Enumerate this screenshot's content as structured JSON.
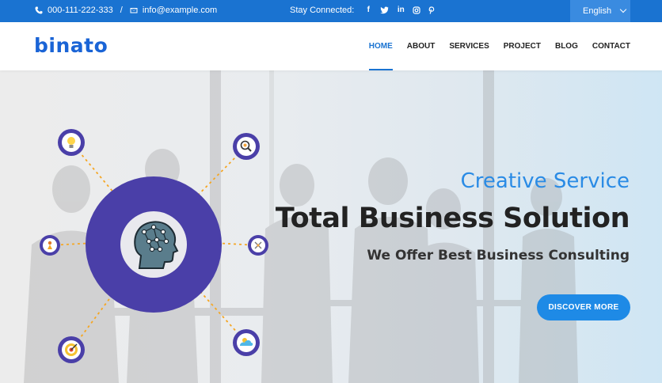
{
  "topbar": {
    "phone": "000-111-222-333",
    "separator": "/",
    "email": "info@example.com",
    "social_label": "Stay Connected:",
    "social_icons": [
      "facebook-icon",
      "twitter-icon",
      "linkedin-icon",
      "instagram-icon",
      "pinterest-icon"
    ],
    "language": "English"
  },
  "header": {
    "logo": "binato",
    "nav": [
      "HOME",
      "ABOUT",
      "SERVICES",
      "PROJECT",
      "BLOG",
      "CONTACT"
    ],
    "active": "HOME"
  },
  "hero": {
    "subtitle": "Creative Service",
    "title": "Total Business Solution",
    "description": "We Offer Best Business Consulting",
    "button": "DISCOVER MORE"
  },
  "colors": {
    "topbar": "#1a73d1",
    "brand": "#1a64d6",
    "diagram_ring": "#4a3fa8",
    "connector": "#f5a623",
    "accent_text": "#2a8be5"
  }
}
